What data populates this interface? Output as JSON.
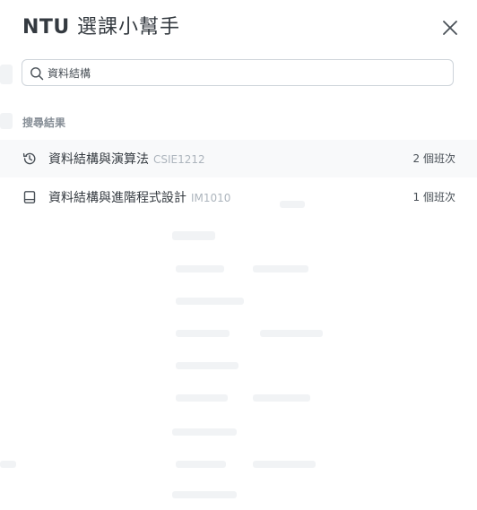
{
  "header": {
    "title_brand": "NTU",
    "title_rest": "選課小幫手",
    "close_icon": "close-icon"
  },
  "search": {
    "value": "資料結構",
    "icon": "search-icon"
  },
  "results": {
    "section_label": "搜尋結果",
    "items": [
      {
        "icon": "history-icon",
        "name": "資料結構與演算法",
        "code": "CSIE1212",
        "count": "2 個班次"
      },
      {
        "icon": "book-icon",
        "name": "資料結構與進階程式設計",
        "code": "IM1010",
        "count": "1 個班次"
      }
    ]
  },
  "colors": {
    "title": "#343a40",
    "muted": "#868e96",
    "code": "#adb5bd",
    "active_row": "#f8f9fa",
    "border": "#ced4da"
  }
}
